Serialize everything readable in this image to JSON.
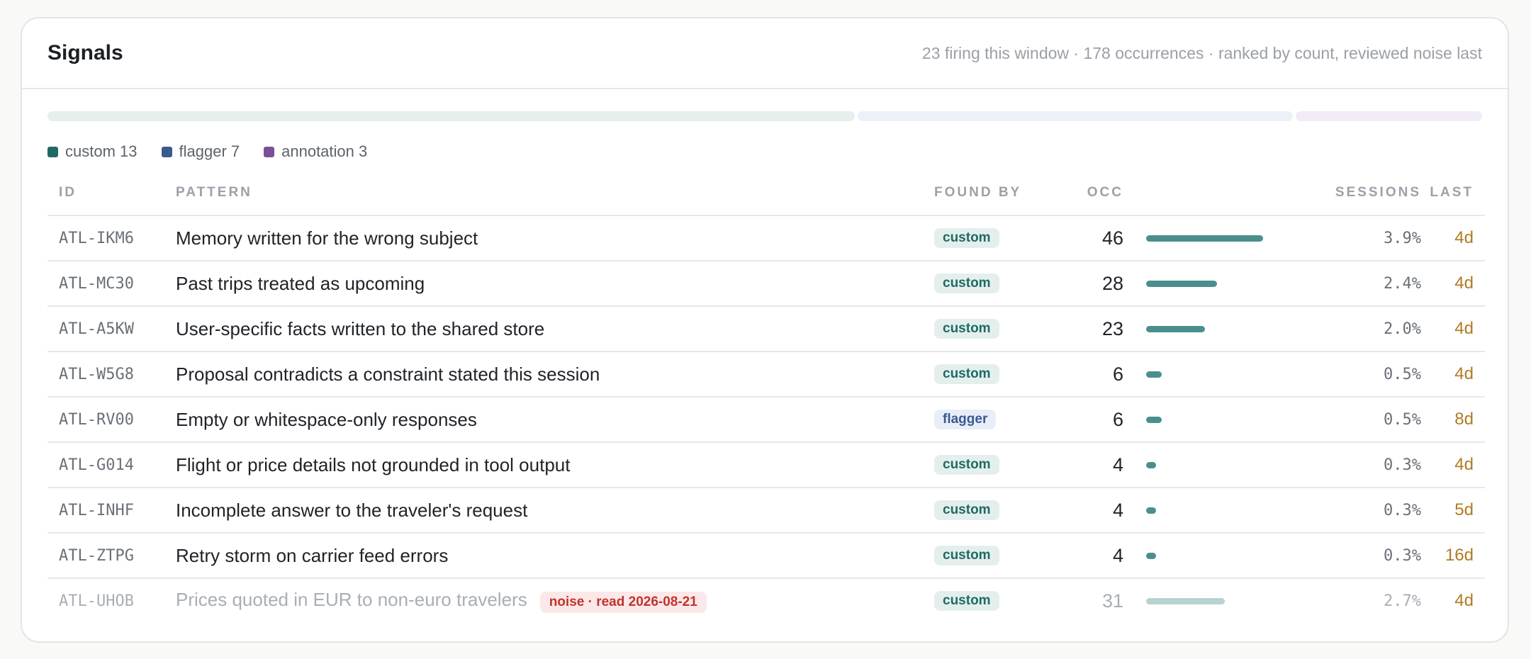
{
  "panel": {
    "title": "Signals",
    "summary": "23 firing this window · 178 occurrences · ranked by count, reviewed noise last"
  },
  "distribution": [
    {
      "key": "custom",
      "label": "custom 13",
      "count": 13,
      "color": "#1f6b64",
      "track": "#e5efed"
    },
    {
      "key": "flagger",
      "label": "flagger 7",
      "count": 7,
      "color": "#3a5a8f",
      "track": "#ecf1f8"
    },
    {
      "key": "annotation",
      "label": "annotation 3",
      "count": 3,
      "color": "#7a4f9a",
      "track": "#f1ecf6"
    }
  ],
  "columns": {
    "id": "ID",
    "pattern": "PATTERN",
    "found_by": "FOUND BY",
    "occ": "OCC",
    "sessions": "SESSIONS",
    "last": "LAST"
  },
  "max_occ": 46,
  "rows": [
    {
      "id": "ATL-IKM6",
      "pattern": "Memory written for the wrong subject",
      "found_by": "custom",
      "occ": "46",
      "occ_value": 46,
      "sessions": "3.9%",
      "last": "4d"
    },
    {
      "id": "ATL-MC30",
      "pattern": "Past trips treated as upcoming",
      "found_by": "custom",
      "occ": "28",
      "occ_value": 28,
      "sessions": "2.4%",
      "last": "4d"
    },
    {
      "id": "ATL-A5KW",
      "pattern": "User-specific facts written to the shared store",
      "found_by": "custom",
      "occ": "23",
      "occ_value": 23,
      "sessions": "2.0%",
      "last": "4d"
    },
    {
      "id": "ATL-W5G8",
      "pattern": "Proposal contradicts a constraint stated this session",
      "found_by": "custom",
      "occ": "6",
      "occ_value": 6,
      "sessions": "0.5%",
      "last": "4d"
    },
    {
      "id": "ATL-RV00",
      "pattern": "Empty or whitespace-only responses",
      "found_by": "flagger",
      "occ": "6",
      "occ_value": 6,
      "sessions": "0.5%",
      "last": "8d"
    },
    {
      "id": "ATL-G014",
      "pattern": "Flight or price details not grounded in tool output",
      "found_by": "custom",
      "occ": "4",
      "occ_value": 4,
      "sessions": "0.3%",
      "last": "4d"
    },
    {
      "id": "ATL-INHF",
      "pattern": "Incomplete answer to the traveler's request",
      "found_by": "custom",
      "occ": "4",
      "occ_value": 4,
      "sessions": "0.3%",
      "last": "5d"
    },
    {
      "id": "ATL-ZTPG",
      "pattern": "Retry storm on carrier feed errors",
      "found_by": "custom",
      "occ": "4",
      "occ_value": 4,
      "sessions": "0.3%",
      "last": "16d"
    },
    {
      "id": "ATL-UHOB",
      "pattern": "Prices quoted in EUR to non-euro travelers",
      "found_by": "custom",
      "occ": "31",
      "occ_value": 31,
      "sessions": "2.7%",
      "last": "4d",
      "noise_tag": "noise · read 2026-08-21"
    }
  ]
}
